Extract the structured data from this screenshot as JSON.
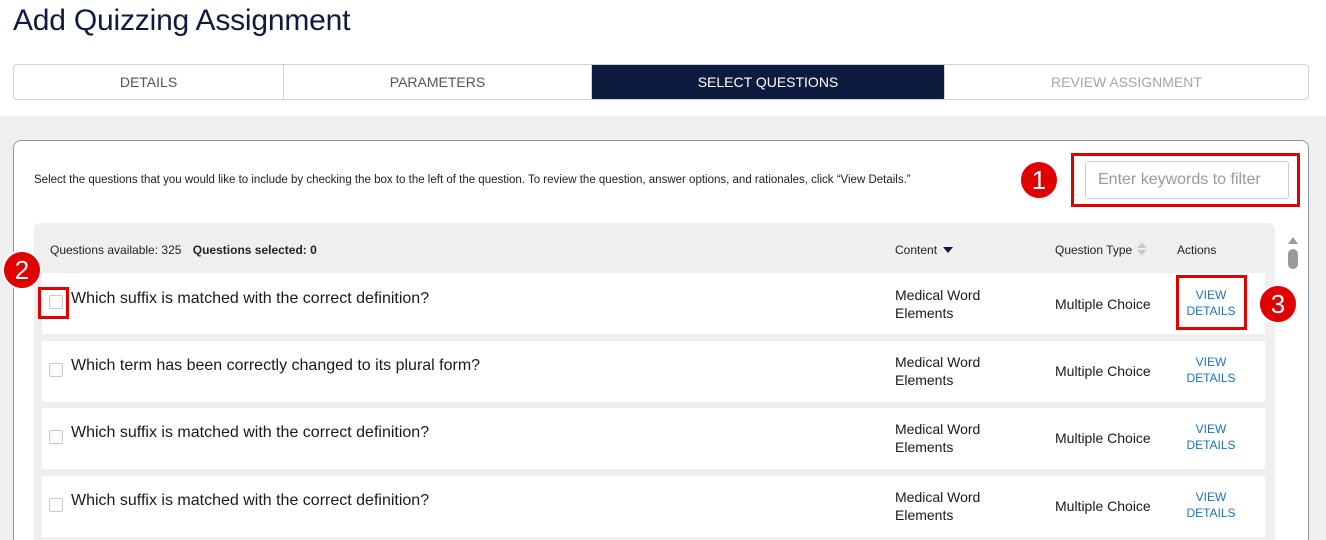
{
  "page": {
    "title": "Add Quizzing Assignment"
  },
  "steps": [
    {
      "label": "DETAILS",
      "state": "default"
    },
    {
      "label": "PARAMETERS",
      "state": "default"
    },
    {
      "label": "SELECT QUESTIONS",
      "state": "active"
    },
    {
      "label": "REVIEW ASSIGNMENT",
      "state": "disabled"
    }
  ],
  "instructions": "Select the questions that you would like to include by checking the box to the left of the question. To review the question, answer options, and rationales, click “View Details.”",
  "filter": {
    "placeholder": "Enter keywords to filter",
    "value": ""
  },
  "table": {
    "available_label": "Questions available: 325",
    "selected_label": "Questions selected: 0",
    "headers": {
      "content": "Content",
      "type": "Question Type",
      "actions": "Actions"
    },
    "rows": [
      {
        "checked": false,
        "question": "Which suffix is matched with the correct definition?",
        "content_line1": "Medical Word",
        "content_line2": "Elements",
        "type": "Multiple Choice",
        "action_line1": "VIEW",
        "action_line2": "DETAILS"
      },
      {
        "checked": false,
        "question": "Which term has been correctly changed to its plural form?",
        "content_line1": "Medical Word",
        "content_line2": "Elements",
        "type": "Multiple Choice",
        "action_line1": "VIEW",
        "action_line2": "DETAILS"
      },
      {
        "checked": false,
        "question": "Which suffix is matched with the correct definition?",
        "content_line1": "Medical Word",
        "content_line2": "Elements",
        "type": "Multiple Choice",
        "action_line1": "VIEW",
        "action_line2": "DETAILS"
      },
      {
        "checked": false,
        "question": "Which suffix is matched with the correct definition?",
        "content_line1": "Medical Word",
        "content_line2": "Elements",
        "type": "Multiple Choice",
        "action_line1": "VIEW",
        "action_line2": "DETAILS"
      }
    ]
  },
  "callouts": [
    "1",
    "2",
    "3"
  ],
  "icons": {
    "content_sort": "sort-descending-icon",
    "type_sort": "sort-both-icon",
    "scroll": "scroll-up-arrow-icon"
  },
  "colors": {
    "brand_navy": "#0d1b3e",
    "link_blue": "#1e73b8",
    "callout_red": "#e00000"
  }
}
